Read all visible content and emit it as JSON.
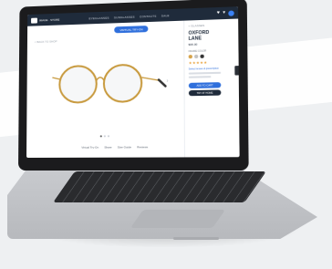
{
  "header": {
    "brand": "IMAGE · STORE",
    "links": [
      "EYEGLASSES",
      "SUNGLASSES",
      "CONTACTS",
      "SALE"
    ]
  },
  "product_view": {
    "tryon_label": "VIRTUAL TRY-ON",
    "breadcrumb": "< BACK TO SHOP"
  },
  "gallery": {
    "bottom_links": [
      "Virtual Try-On",
      "Share",
      "Size Guide",
      "Reviews"
    ]
  },
  "product_panel": {
    "back": "< GLASSES",
    "title": "OXFORD LANE",
    "price": "$95.00",
    "color_label": "FRAME COLOR",
    "colors": [
      "#d6a34a",
      "#c2c2c2",
      "#333333"
    ],
    "rating_label": "★★★★★",
    "lens_link": "Select lenses & prescription",
    "primary_cta": "ADD TO CART",
    "secondary_cta": "TRY AT HOME"
  }
}
